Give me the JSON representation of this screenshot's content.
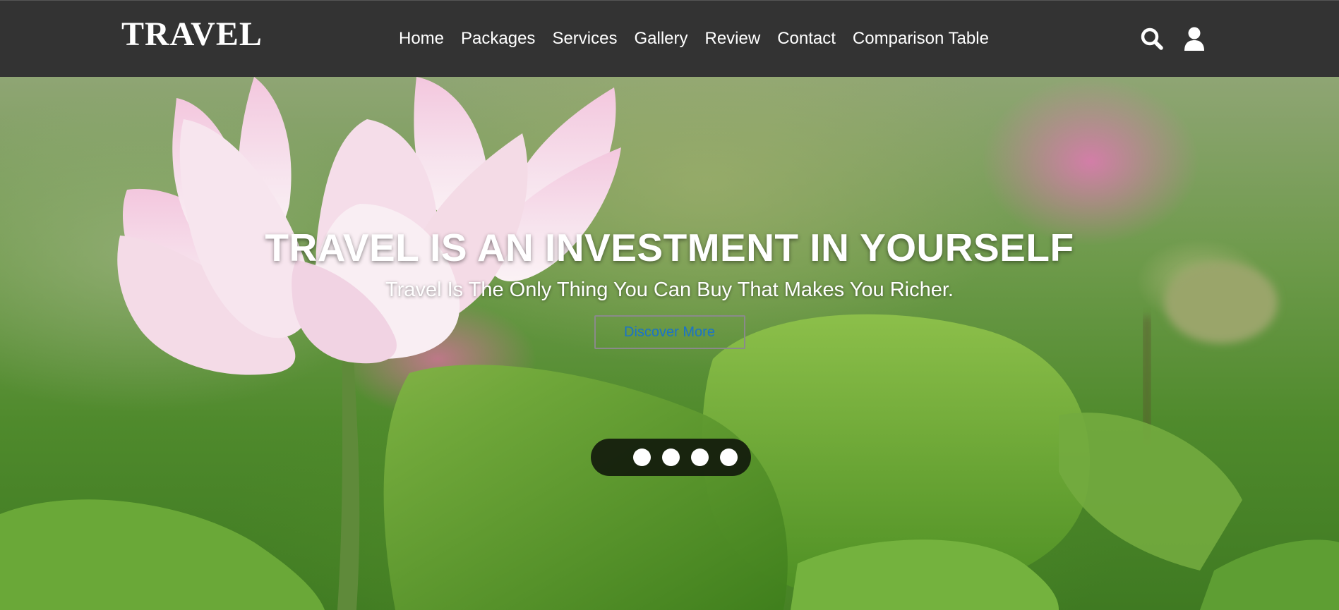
{
  "header": {
    "logo": "TRAVEL",
    "nav": [
      {
        "label": "Home"
      },
      {
        "label": "Packages"
      },
      {
        "label": "Services"
      },
      {
        "label": "Gallery"
      },
      {
        "label": "Review"
      },
      {
        "label": "Contact"
      },
      {
        "label": "Comparison Table"
      }
    ],
    "icons": [
      "search-icon",
      "user-icon"
    ],
    "background": "#333333"
  },
  "hero": {
    "title": "TRAVEL IS AN INVESTMENT IN YOURSELF",
    "subtitle": "Travel Is The Only Thing You Can Buy That Makes You Richer.",
    "cta_label": "Discover More",
    "cta_color": "#1a73c9",
    "background_image": "lotus-flower-pond",
    "slides": 4,
    "active_slide": 1
  }
}
